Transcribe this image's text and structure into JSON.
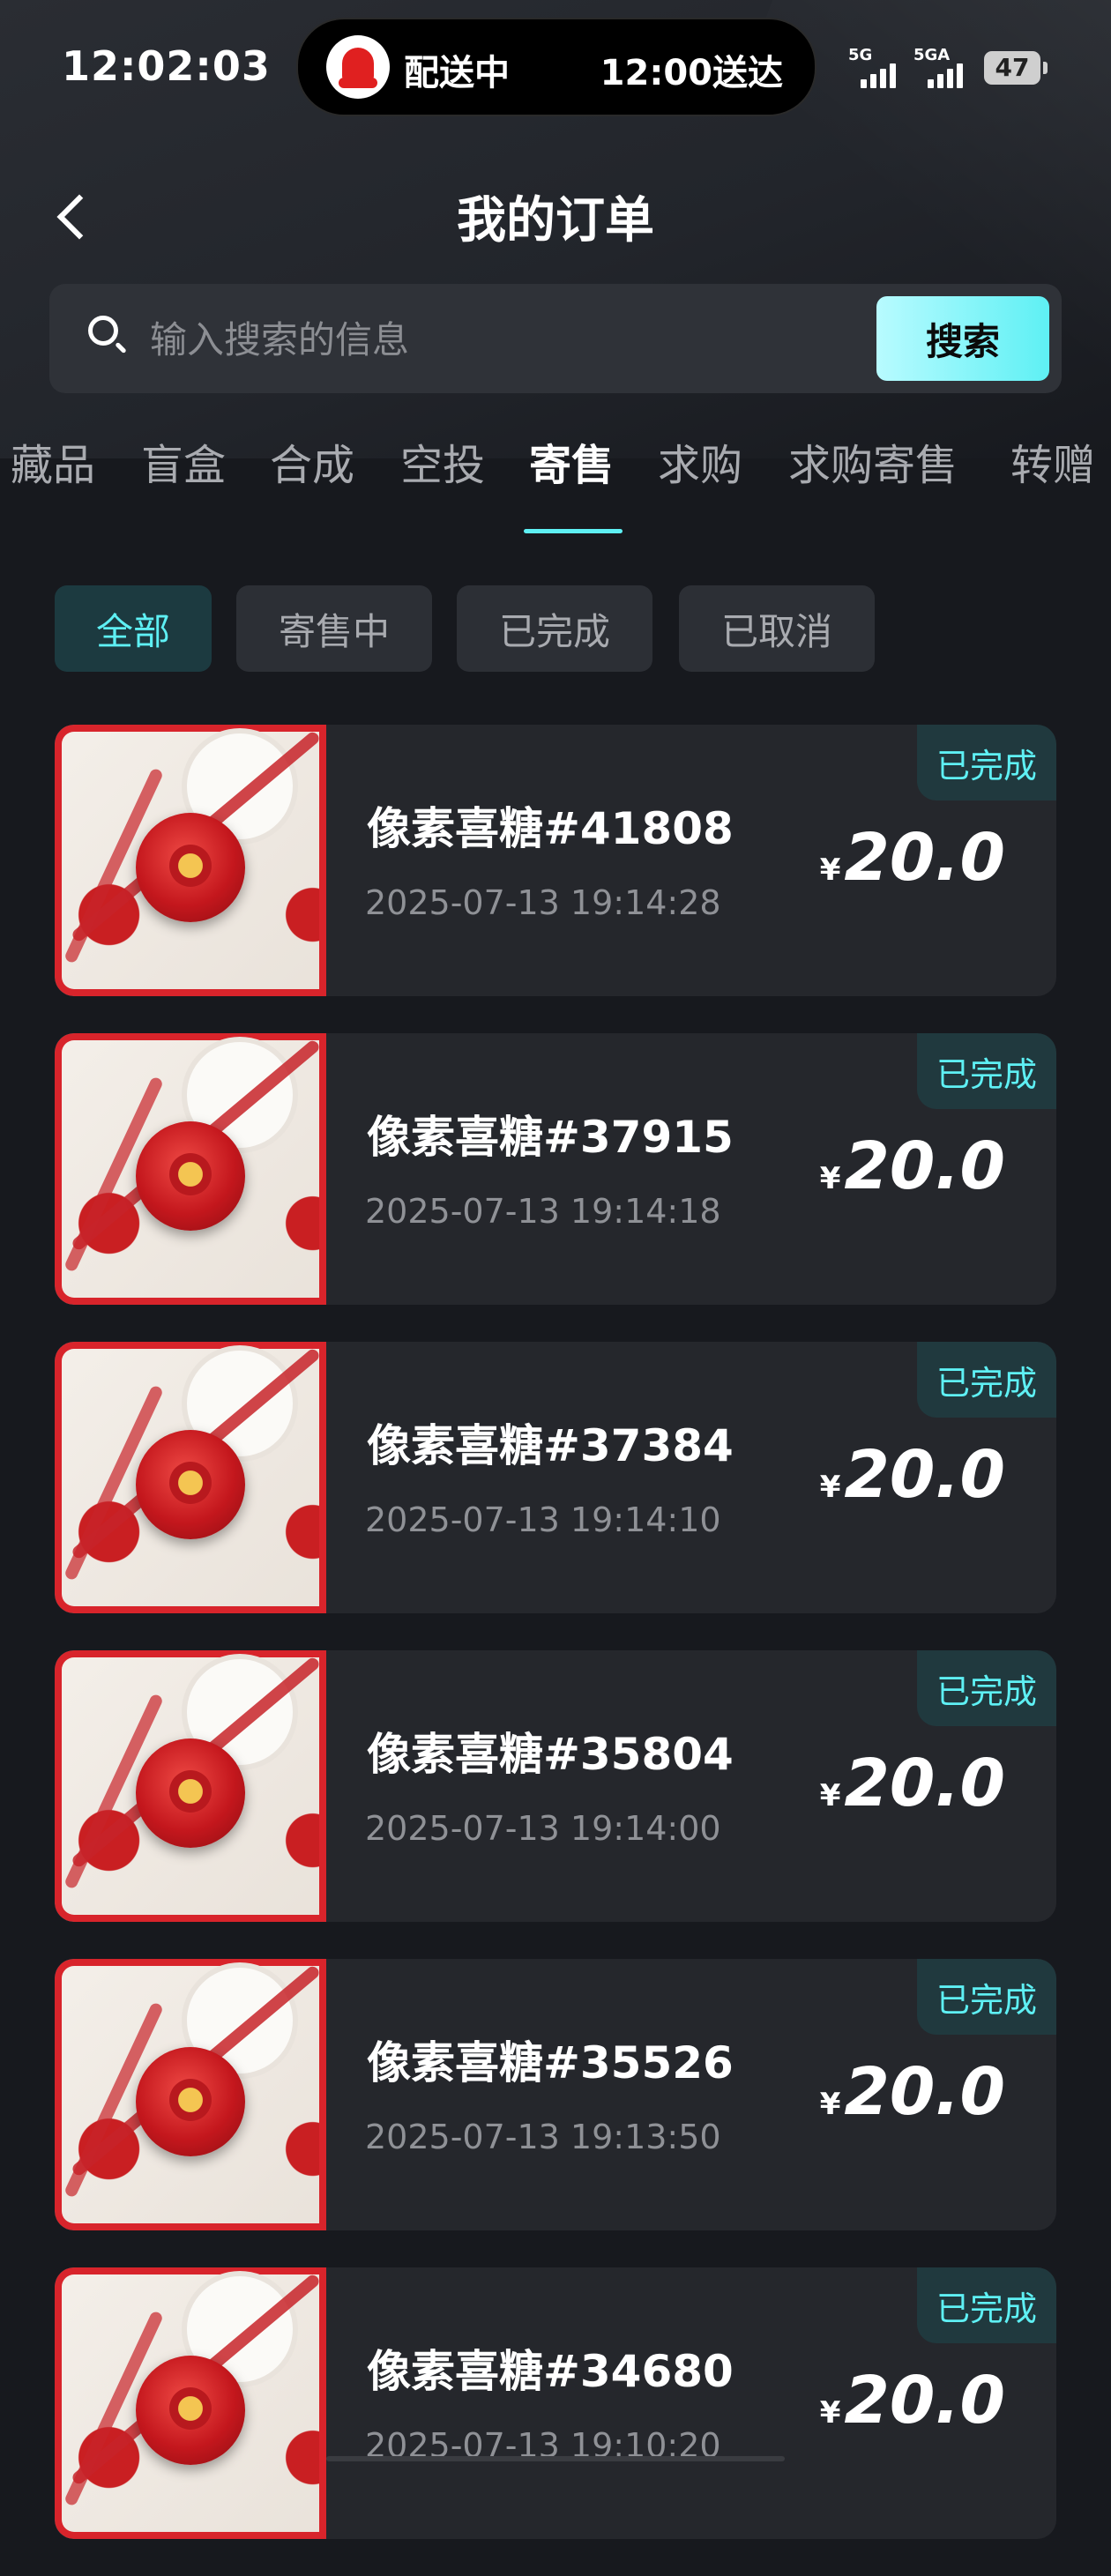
{
  "status_bar": {
    "time": "12:02:03",
    "delivery_left": "配送中",
    "delivery_right": "12:00送达",
    "signal1": "5G",
    "signal2": "5GA",
    "battery": "47"
  },
  "header": {
    "title": "我的订单"
  },
  "search": {
    "placeholder": "输入搜索的信息",
    "button": "搜索"
  },
  "tabs": [
    "藏品",
    "盲盒",
    "合成",
    "空投",
    "寄售",
    "求购",
    "求购寄售",
    "转赠"
  ],
  "active_tab": "寄售",
  "filters": [
    "全部",
    "寄售中",
    "已完成",
    "已取消"
  ],
  "active_filter": "全部",
  "orders": [
    {
      "name": "像素喜糖#41808",
      "time": "2025-07-13 19:14:28",
      "currency": "¥",
      "price": "20.0",
      "status": "已完成"
    },
    {
      "name": "像素喜糖#37915",
      "time": "2025-07-13 19:14:18",
      "currency": "¥",
      "price": "20.0",
      "status": "已完成"
    },
    {
      "name": "像素喜糖#37384",
      "time": "2025-07-13 19:14:10",
      "currency": "¥",
      "price": "20.0",
      "status": "已完成"
    },
    {
      "name": "像素喜糖#35804",
      "time": "2025-07-13 19:14:00",
      "currency": "¥",
      "price": "20.0",
      "status": "已完成"
    },
    {
      "name": "像素喜糖#35526",
      "time": "2025-07-13 19:13:50",
      "currency": "¥",
      "price": "20.0",
      "status": "已完成"
    },
    {
      "name": "像素喜糖#34680",
      "time": "2025-07-13 19:10:20",
      "currency": "¥",
      "price": "20.0",
      "status": "已完成"
    }
  ],
  "colors": {
    "accent": "#5ef0f4",
    "background": "#17191e",
    "card": "#25272c"
  }
}
